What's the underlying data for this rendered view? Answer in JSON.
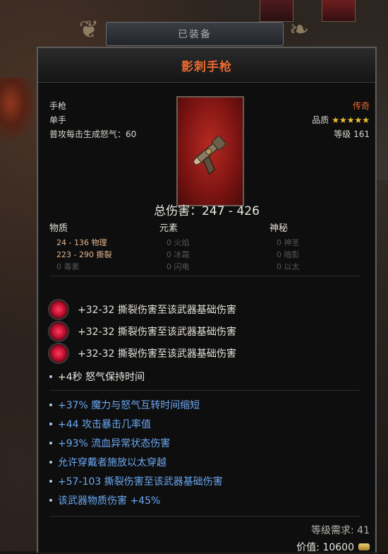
{
  "header": {
    "label": "已装备"
  },
  "item": {
    "name": "影刺手枪",
    "type": "手枪",
    "hand": "单手",
    "rage": "普攻每击生成怒气：60",
    "rarity": "传奇",
    "quality_label": "品质",
    "stars": "★★★★★",
    "level": "等级 161"
  },
  "damage": {
    "total": "总伤害：247 - 426",
    "columns": [
      {
        "head": "物质",
        "rows": [
          {
            "text": "24 - 136 物理",
            "active": true
          },
          {
            "text": "223 - 290 撕裂",
            "active": true
          },
          {
            "text": "0 毒素",
            "active": false
          }
        ]
      },
      {
        "head": "元素",
        "rows": [
          {
            "text": "0 火焰",
            "active": false
          },
          {
            "text": "0 冰霜",
            "active": false
          },
          {
            "text": "0 闪电",
            "active": false
          }
        ]
      },
      {
        "head": "神秘",
        "rows": [
          {
            "text": "0 神圣",
            "active": false
          },
          {
            "text": "0 暗影",
            "active": false
          },
          {
            "text": "0 以太",
            "active": false
          }
        ]
      }
    ]
  },
  "sockets": [
    "+32-32 撕裂伤害至该武器基础伤害",
    "+32-32 撕裂伤害至该武器基础伤害",
    "+32-32 撕裂伤害至该武器基础伤害"
  ],
  "base_affix": "+4秒 怒气保持时间",
  "affixes": [
    "+37% 魔力与怒气互转时间缩短",
    "+44 攻击暴击几率值",
    "+93% 流血异常状态伤害",
    "允许穿戴者施放以太穿越",
    "+57-103 撕裂伤害至该武器基础伤害",
    "该武器物质伤害 +45%"
  ],
  "footer": {
    "requirement": "等级需求: 41",
    "price": "价值: 10600"
  },
  "colors": {
    "legendary": "#e8692f",
    "affix_blue": "#6aa8f0",
    "star_gold": "#f2c130"
  }
}
